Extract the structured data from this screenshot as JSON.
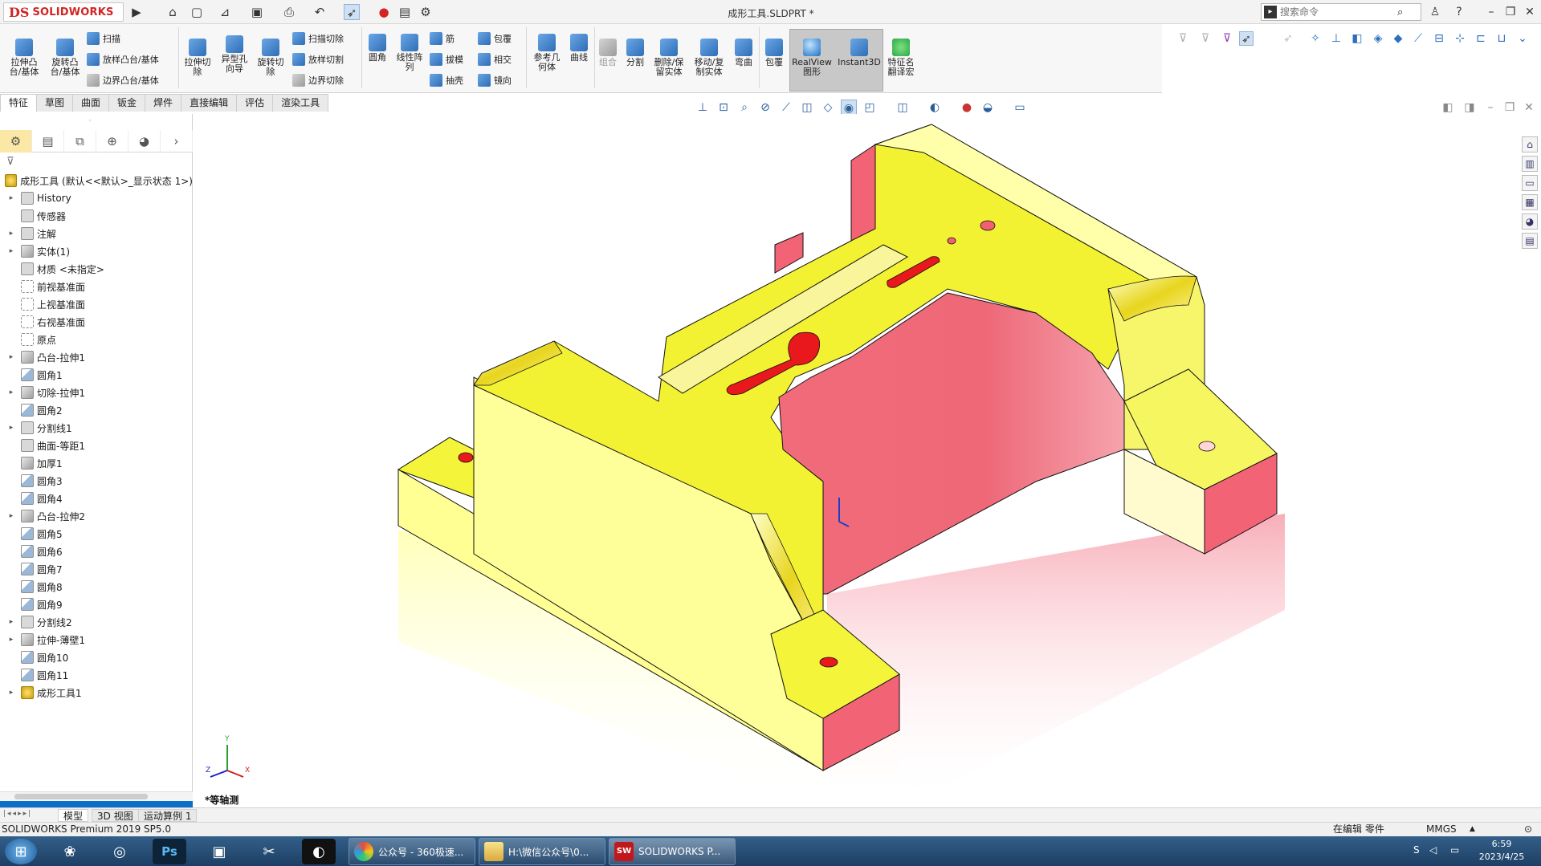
{
  "app": {
    "brand_ds": "DS",
    "brand": "SOLIDWORKS",
    "document_title": "成形工具.SLDPRT *",
    "search_placeholder": "搜索命令",
    "window_controls": [
      "help-icon",
      "minimize-icon",
      "restore-icon",
      "close-icon"
    ]
  },
  "ribbon": {
    "large_buttons": [
      {
        "id": "extrude-boss",
        "label": "拉伸凸\n台/基体"
      },
      {
        "id": "revolve-boss",
        "label": "旋转凸\n台/基体"
      },
      {
        "id": "extrude-cut",
        "label": "拉伸切\n除"
      },
      {
        "id": "hole-wizard",
        "label": "异型孔\n向导"
      },
      {
        "id": "revolve-cut",
        "label": "旋转切\n除"
      },
      {
        "id": "fillet",
        "label": "圆角"
      },
      {
        "id": "linear-pattern",
        "label": "线性阵\n列"
      },
      {
        "id": "ref-geometry",
        "label": "参考几\n何体"
      },
      {
        "id": "curves",
        "label": "曲线"
      },
      {
        "id": "combine",
        "label": "组合"
      },
      {
        "id": "split",
        "label": "分割"
      },
      {
        "id": "delete-keep-body",
        "label": "删除/保\n留实体"
      },
      {
        "id": "move-copy-body",
        "label": "移动/复\n制实体"
      },
      {
        "id": "flex",
        "label": "弯曲"
      },
      {
        "id": "wrap",
        "label": "包覆"
      },
      {
        "id": "realview",
        "label": "RealView\n图形"
      },
      {
        "id": "instant3d",
        "label": "Instant3D"
      },
      {
        "id": "feature-translate",
        "label": "特征名\n翻译宏"
      }
    ],
    "small_buttons": [
      {
        "id": "sweep",
        "label": "扫描"
      },
      {
        "id": "loft-boss",
        "label": "放样凸台/基体"
      },
      {
        "id": "boundary-boss",
        "label": "边界凸台/基体"
      },
      {
        "id": "swept-cut",
        "label": "扫描切除"
      },
      {
        "id": "lofted-cut",
        "label": "放样切割"
      },
      {
        "id": "boundary-cut",
        "label": "边界切除"
      },
      {
        "id": "rib",
        "label": "筋"
      },
      {
        "id": "draft",
        "label": "拔模"
      },
      {
        "id": "shell",
        "label": "抽壳"
      },
      {
        "id": "wrap-small",
        "label": "包覆"
      },
      {
        "id": "intersect",
        "label": "相交"
      },
      {
        "id": "mirror",
        "label": "镜向"
      }
    ]
  },
  "command_tabs": [
    "特征",
    "草图",
    "曲面",
    "钣金",
    "焊件",
    "直接编辑",
    "评估",
    "渲染工具"
  ],
  "feature_tree": {
    "root": "成形工具 (默认<<默认>_显示状态 1>)",
    "items": [
      {
        "label": "History",
        "arrow": true,
        "icon": "fold"
      },
      {
        "label": "传感器",
        "arrow": false,
        "icon": "fold"
      },
      {
        "label": "注解",
        "arrow": true,
        "icon": "fold"
      },
      {
        "label": "实体(1)",
        "arrow": true,
        "icon": "body"
      },
      {
        "label": "材质 <未指定>",
        "arrow": false,
        "icon": "fold"
      },
      {
        "label": "前视基准面",
        "arrow": false,
        "icon": "plane"
      },
      {
        "label": "上视基准面",
        "arrow": false,
        "icon": "plane"
      },
      {
        "label": "右视基准面",
        "arrow": false,
        "icon": "plane"
      },
      {
        "label": "原点",
        "arrow": false,
        "icon": "plane"
      },
      {
        "label": "凸台-拉伸1",
        "arrow": true,
        "icon": "body"
      },
      {
        "label": "圆角1",
        "arrow": false,
        "icon": "fillet"
      },
      {
        "label": "切除-拉伸1",
        "arrow": true,
        "icon": "body"
      },
      {
        "label": "圆角2",
        "arrow": false,
        "icon": "fillet"
      },
      {
        "label": "分割线1",
        "arrow": true,
        "icon": "fold"
      },
      {
        "label": "曲面-等距1",
        "arrow": false,
        "icon": "fold"
      },
      {
        "label": "加厚1",
        "arrow": false,
        "icon": "body"
      },
      {
        "label": "圆角3",
        "arrow": false,
        "icon": "fillet"
      },
      {
        "label": "圆角4",
        "arrow": false,
        "icon": "fillet"
      },
      {
        "label": "凸台-拉伸2",
        "arrow": true,
        "icon": "body"
      },
      {
        "label": "圆角5",
        "arrow": false,
        "icon": "fillet"
      },
      {
        "label": "圆角6",
        "arrow": false,
        "icon": "fillet"
      },
      {
        "label": "圆角7",
        "arrow": false,
        "icon": "fillet"
      },
      {
        "label": "圆角8",
        "arrow": false,
        "icon": "fillet"
      },
      {
        "label": "圆角9",
        "arrow": false,
        "icon": "fillet"
      },
      {
        "label": "分割线2",
        "arrow": true,
        "icon": "fold"
      },
      {
        "label": "拉伸-薄壁1",
        "arrow": true,
        "icon": "body"
      },
      {
        "label": "圆角10",
        "arrow": false,
        "icon": "fillet"
      },
      {
        "label": "圆角11",
        "arrow": false,
        "icon": "fillet"
      },
      {
        "label": "成形工具1",
        "arrow": true,
        "icon": "tool"
      }
    ]
  },
  "viewport": {
    "view_name": "*等轴测",
    "triad": {
      "x": "X",
      "y": "Y",
      "z": "Z"
    }
  },
  "bottom_tabs": [
    "模型",
    "3D 视图",
    "运动算例 1"
  ],
  "status_bar": {
    "product": "SOLIDWORKS Premium 2019 SP5.0",
    "mode": "在编辑 零件",
    "units": "MMGS"
  },
  "taskbar": {
    "tasks": [
      {
        "label": "公众号 - 360极速..."
      },
      {
        "label": "H:\\微信公众号\\0..."
      },
      {
        "label": "SOLIDWORKS P..."
      }
    ],
    "time": "6:59",
    "date": "2023/4/25"
  },
  "colors": {
    "part_yellow": "#f2f231",
    "part_face": "#ffff9a",
    "cut_red": "#f06070",
    "accent_blue": "#0b6fc8",
    "brand_red": "#d42323"
  }
}
